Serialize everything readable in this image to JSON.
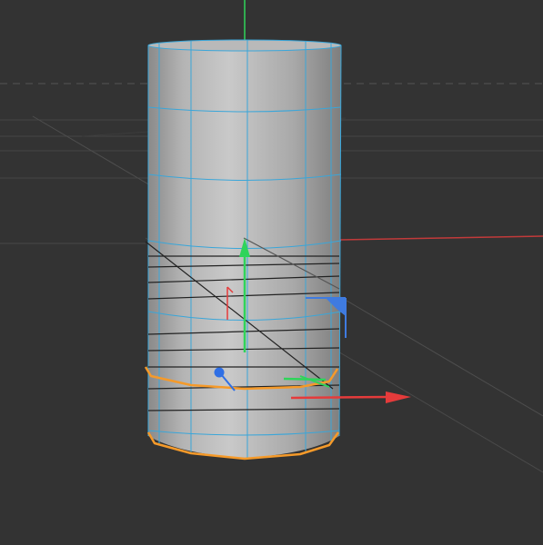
{
  "viewport": {
    "background": "#333333"
  },
  "object": {
    "type": "cylinder",
    "selection": "edge loop",
    "colors": {
      "wire": "#3aa6d9",
      "selected_edges": "#f59a2a",
      "surface_light": "#c8c8c8",
      "surface_dark": "#888888"
    }
  },
  "gizmo": {
    "colors": {
      "x_axis": "#e53b3b",
      "y_axis": "#2fd45a",
      "z_axis": "#2f6fe5",
      "plane_handle": "#3f7be0"
    }
  }
}
